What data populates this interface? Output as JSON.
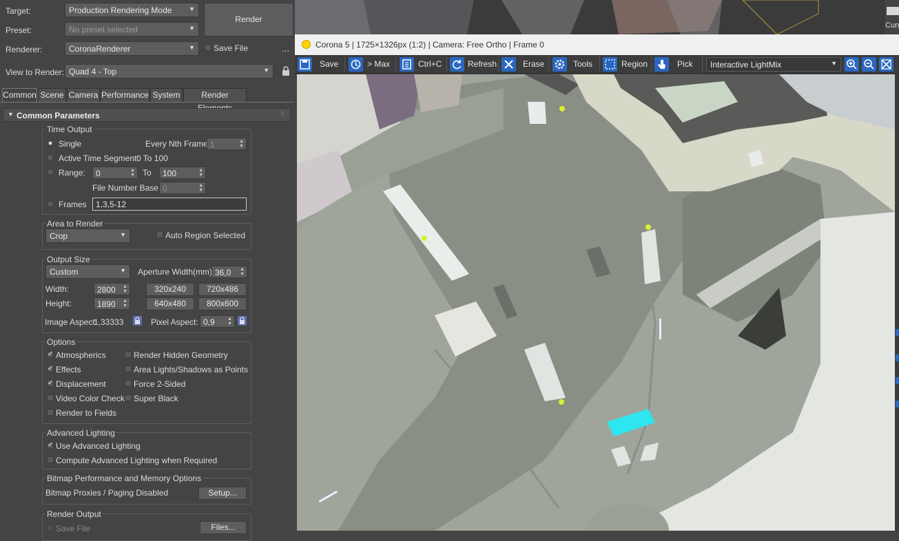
{
  "top": {
    "target_label": "Target:",
    "target_value": "Production Rendering Mode",
    "preset_label": "Preset:",
    "preset_value": "No preset selected",
    "renderer_label": "Renderer:",
    "renderer_value": "CoronaRenderer",
    "save_file_label": "Save File",
    "ellipsis": "...",
    "view_label": "View to Render:",
    "view_value": "Quad 4 - Top",
    "render_button": "Render"
  },
  "tabs": [
    "Common",
    "Scene",
    "Camera",
    "Performance",
    "System",
    "Render Elements"
  ],
  "rollout_title": "Common Parameters",
  "time_output": {
    "title": "Time Output",
    "single": "Single",
    "every_nth": "Every Nth Frame:",
    "every_nth_value": "1",
    "active_segment": "Active Time Segment:",
    "active_segment_value": "0 To 100",
    "range": "Range:",
    "range_from": "0",
    "to": "To",
    "range_to": "100",
    "file_number_base": "File Number Base:",
    "file_number_base_value": "0",
    "frames": "Frames",
    "frames_value": "1,3,5-12"
  },
  "area": {
    "title": "Area to Render",
    "mode": "Crop",
    "auto_region": "Auto Region Selected"
  },
  "output_size": {
    "title": "Output Size",
    "preset": "Custom",
    "aperture_label": "Aperture Width(mm):",
    "aperture_value": "36,0",
    "width_label": "Width:",
    "width_value": "2800",
    "height_label": "Height:",
    "height_value": "1890",
    "p1": "320x240",
    "p2": "720x486",
    "p3": "640x480",
    "p4": "800x600",
    "image_aspect_label": "Image Aspect:",
    "image_aspect_value": "1,33333",
    "pixel_aspect_label": "Pixel Aspect:",
    "pixel_aspect_value": "0,9"
  },
  "options": {
    "title": "Options",
    "atmospherics": "Atmospherics",
    "render_hidden": "Render Hidden Geometry",
    "effects": "Effects",
    "area_lights": "Area Lights/Shadows as Points",
    "displacement": "Displacement",
    "force_2_sided": "Force 2-Sided",
    "video_color_check": "Video Color Check",
    "super_black": "Super Black",
    "render_to_fields": "Render to Fields"
  },
  "advanced_lighting": {
    "title": "Advanced Lighting",
    "use": "Use Advanced Lighting",
    "compute": "Compute Advanced Lighting when Required"
  },
  "bitmap": {
    "title": "Bitmap Performance and Memory Options",
    "status": "Bitmap Proxies / Paging Disabled",
    "setup": "Setup..."
  },
  "render_output": {
    "title": "Render Output",
    "save_file": "Save File",
    "files": "Files..."
  },
  "vfb": {
    "title": "Corona 5 | 1725×1326px (1:2) | Camera: Free Ortho | Frame 0",
    "save": "Save",
    "max": "> Max",
    "ctrlc": "Ctrl+C",
    "refresh": "Refresh",
    "erase": "Erase",
    "tools": "Tools",
    "region": "Region",
    "pick": "Pick",
    "lightmix": "Interactive LightMix"
  },
  "bg_partial": "Curr"
}
